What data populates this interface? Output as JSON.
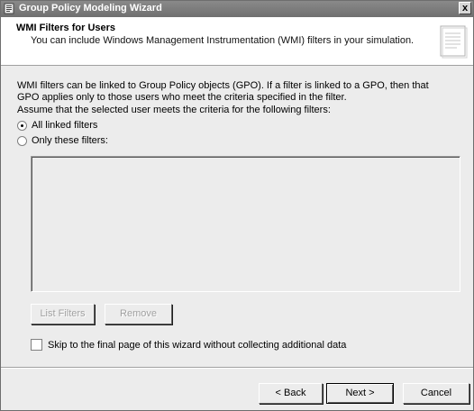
{
  "window": {
    "title": "Group Policy Modeling Wizard",
    "close_label": "x"
  },
  "header": {
    "title": "WMI Filters for Users",
    "subtitle": "You can include Windows Management Instrumentation (WMI) filters in your simulation."
  },
  "content": {
    "description_line1": "WMI filters can be linked to Group Policy objects (GPO). If a filter is linked to a GPO, then that",
    "description_line2": "GPO applies only to those users who meet the criteria specified in the filter.",
    "assume_text": "Assume that the selected user meets the criteria for the following filters:",
    "radio_all": {
      "label": "All linked filters",
      "checked": true
    },
    "radio_only": {
      "label": "Only these filters:",
      "checked": false
    },
    "filters": [],
    "list_filters_label": "List Filters",
    "remove_label": "Remove",
    "skip_label": "Skip to the final page of this wizard without collecting additional data",
    "skip_checked": false
  },
  "footer": {
    "back_label": "< Back",
    "next_label": "Next >",
    "cancel_label": "Cancel"
  }
}
